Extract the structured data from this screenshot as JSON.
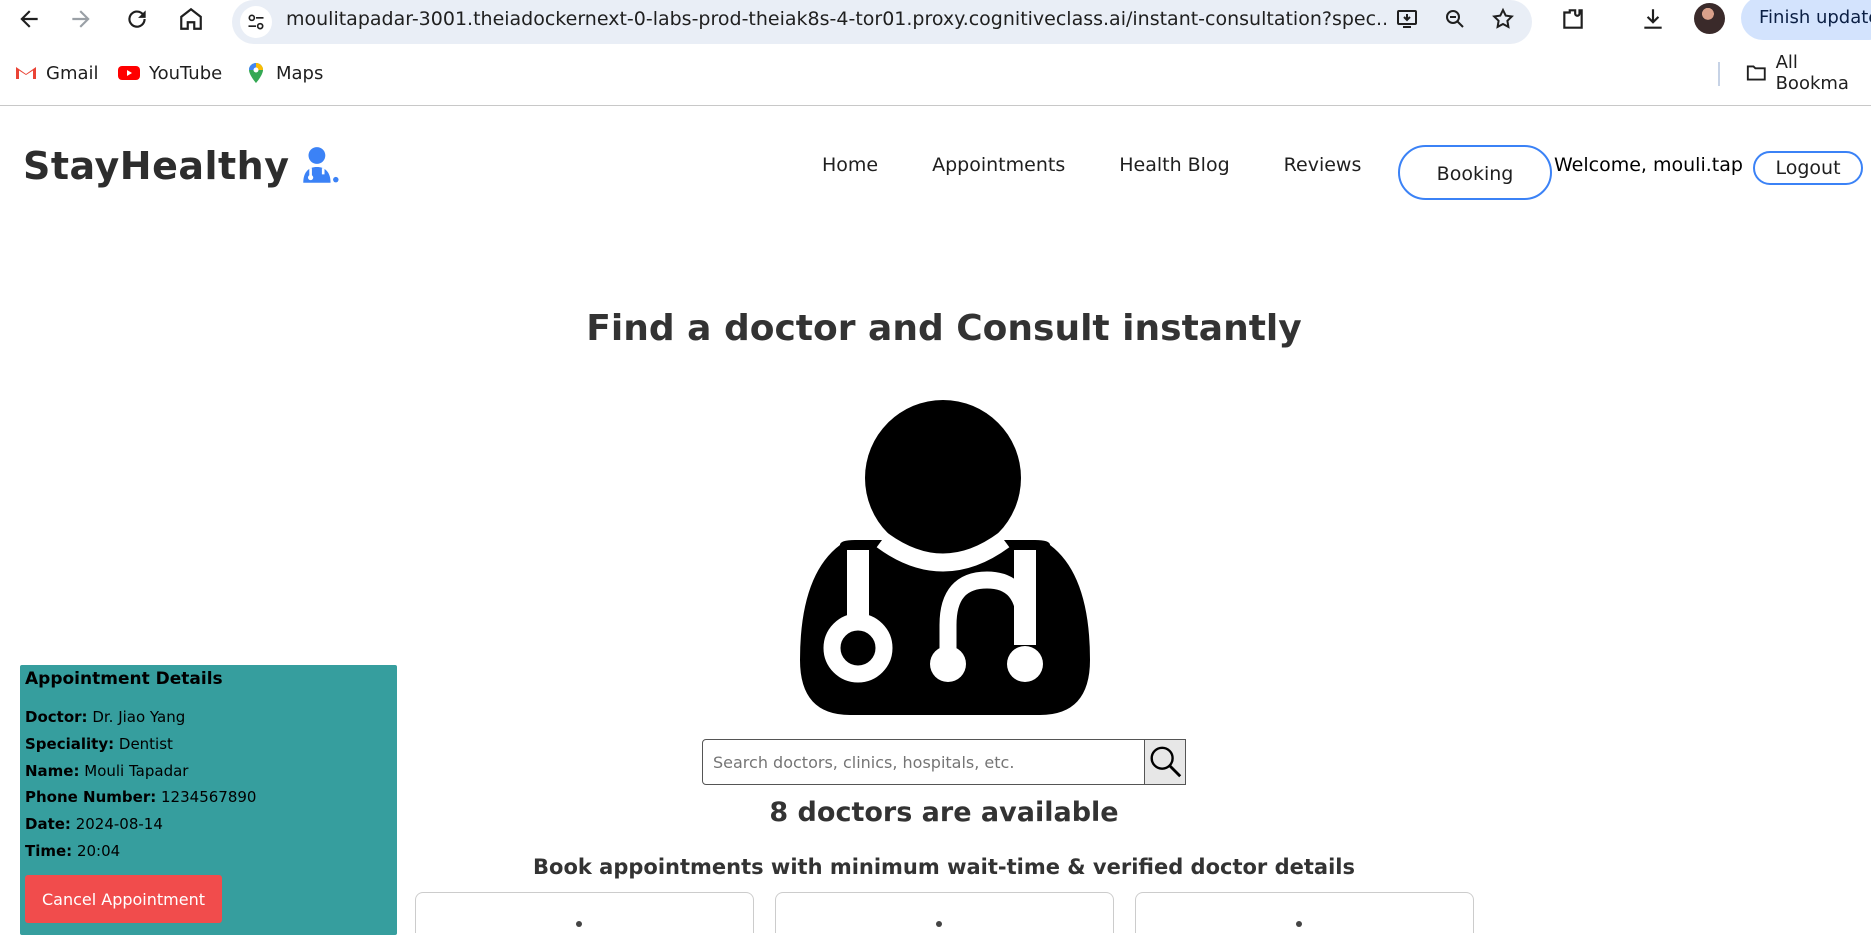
{
  "browser": {
    "url": "moulitapadar-3001.theiadockernext-0-labs-prod-theiak8s-4-tor01.proxy.cognitiveclass.ai/instant-consultation?spec...",
    "finish_update_label": "Finish update",
    "bookmarks": [
      {
        "label": "Gmail",
        "icon": "gmail-icon"
      },
      {
        "label": "YouTube",
        "icon": "youtube-icon"
      },
      {
        "label": "Maps",
        "icon": "maps-icon"
      }
    ],
    "all_bookmarks_label": "All Bookma"
  },
  "navbar": {
    "logo_text": "StayHealthy",
    "links": [
      "Home",
      "Appointments",
      "Health Blog",
      "Reviews"
    ],
    "booking_label": "Booking",
    "welcome_text": "Welcome, mouli.tap",
    "logout_label": "Logout",
    "accent_color": "#3b82f6"
  },
  "main": {
    "headline": "Find a doctor and Consult instantly",
    "search_placeholder": "Search doctors, clinics, hospitals, etc.",
    "available_text": "8 doctors are available",
    "subline": "Book appointments with minimum wait-time & verified doctor details"
  },
  "appointment": {
    "title": "Appointment Details",
    "rows": [
      {
        "label": "Doctor:",
        "value": "Dr. Jiao Yang"
      },
      {
        "label": "Speciality:",
        "value": "Dentist"
      },
      {
        "label": "Name:",
        "value": "Mouli Tapadar"
      },
      {
        "label": "Phone Number:",
        "value": "1234567890"
      },
      {
        "label": "Date:",
        "value": "2024-08-14"
      },
      {
        "label": "Time:",
        "value": "20:04"
      }
    ],
    "cancel_label": "Cancel Appointment",
    "panel_color": "#369e9e",
    "cancel_color": "#f14c4c"
  }
}
